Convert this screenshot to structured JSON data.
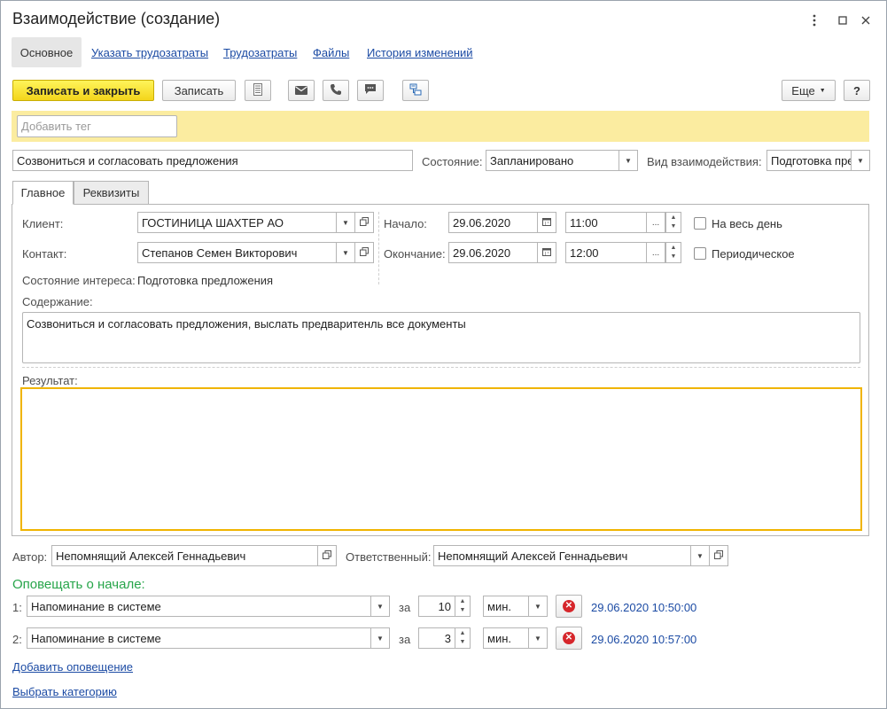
{
  "window": {
    "title": "Взаимодействие (создание)"
  },
  "nav": {
    "selected": "Основное",
    "links": [
      "Указать трудозатраты",
      "Трудозатраты",
      "Файлы",
      "История изменений"
    ]
  },
  "toolbar": {
    "save_close_label": "Записать и закрыть",
    "save_label": "Записать",
    "more_label": "Еще",
    "help_label": "?"
  },
  "tag": {
    "placeholder": "Добавить тег"
  },
  "subject": {
    "value": "Созвониться и согласовать предложения",
    "state_label": "Состояние:",
    "state_value": "Запланировано",
    "kind_label": "Вид взаимодействия:",
    "kind_value": "Подготовка пре"
  },
  "tabs": [
    "Главное",
    "Реквизиты"
  ],
  "main": {
    "client_label": "Клиент:",
    "client_value": "ГОСТИНИЦА ШАХТЕР АО",
    "contact_label": "Контакт:",
    "contact_value": "Степанов Семен Викторович",
    "interest_label": "Состояние интереса:",
    "interest_value": "Подготовка предложения",
    "start_label": "Начало:",
    "start_date": "29.06.2020",
    "start_time": "11:00",
    "end_label": "Окончание:",
    "end_date": "29.06.2020",
    "end_time": "12:00",
    "allday_label": "На весь день",
    "periodic_label": "Периодическое",
    "content_label": "Содержание:",
    "content_value": "Созвониться и согласовать предложения, выслать предваритенль все документы",
    "result_label": "Результат:",
    "result_value": ""
  },
  "footer": {
    "author_label": "Автор:",
    "author_value": "Непомнящий Алексей Геннадьевич",
    "responsible_label": "Ответственный:",
    "responsible_value": "Непомнящий Алексей Геннадьевич"
  },
  "notify": {
    "heading": "Оповещать о начале:",
    "heading_color": "#27a54a",
    "rows": [
      {
        "num": "1:",
        "type": "Напоминание в системе",
        "za": "за",
        "amount": "10",
        "unit": "мин.",
        "datetime": "29.06.2020 10:50:00"
      },
      {
        "num": "2:",
        "type": "Напоминание в системе",
        "za": "за",
        "amount": "3",
        "unit": "мин.",
        "datetime": "29.06.2020 10:57:00"
      }
    ],
    "add_label": "Добавить оповещение",
    "category_label": "Выбрать категорию"
  },
  "colors": {
    "accent_yellow": "#f3d51b",
    "tag_bar": "#fbeca0",
    "link_blue": "#1c4ba4",
    "focus_border": "#f0b400",
    "delete_red": "#d6262b"
  },
  "icons": [
    "kebab-icon",
    "maximize-icon",
    "close-icon",
    "report-icon",
    "mail-icon",
    "phone-icon",
    "chat-icon",
    "structure-icon",
    "calendar-icon",
    "open-icon",
    "delete-icon"
  ]
}
